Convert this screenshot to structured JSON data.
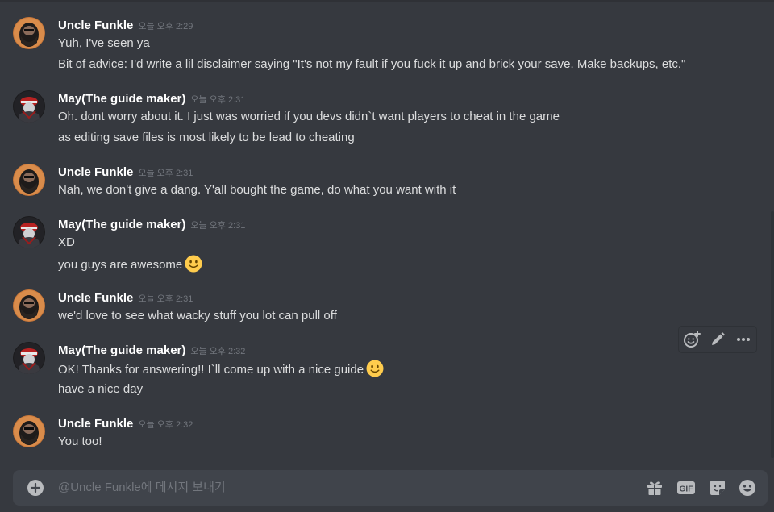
{
  "colors": {
    "background": "#36393f",
    "username": "#ffffff",
    "message_text": "#dcddde",
    "timestamp": "#72767d",
    "composer_bg": "#40444b",
    "icon": "#b9bbbe",
    "emoji_face": "#ffcc4d"
  },
  "messages": [
    {
      "author": "Uncle Funkle",
      "avatar": "uncle-funkle-avatar",
      "time": "오늘 오후 2:29",
      "lines": [
        "Yuh, I've seen ya",
        "Bit of advice: I'd write a lil disclaimer saying \"It's not my fault if you fuck it up and brick your save. Make backups, etc.\""
      ]
    },
    {
      "author": "May(The guide maker)",
      "avatar": "may-avatar",
      "time": "오늘 오후 2:31",
      "lines": [
        "Oh. dont worry about it. I just was worried if you devs didn`t want players to cheat in the game",
        "as editing save files is most likely to be lead to cheating"
      ]
    },
    {
      "author": "Uncle Funkle",
      "avatar": "uncle-funkle-avatar",
      "time": "오늘 오후 2:31",
      "lines": [
        "Nah, we don't give a dang. Y'all bought the game, do what you want with it"
      ]
    },
    {
      "author": "May(The guide maker)",
      "avatar": "may-avatar",
      "time": "오늘 오후 2:31",
      "lines": [
        "XD",
        "you guys are awesome"
      ],
      "emoji": "slightly-smiling-face"
    },
    {
      "author": "Uncle Funkle",
      "avatar": "uncle-funkle-avatar",
      "time": "오늘 오후 2:31",
      "lines": [
        "we'd love to see what wacky stuff you lot can pull off"
      ]
    },
    {
      "author": "May(The guide maker)",
      "avatar": "may-avatar",
      "time": "오늘 오후 2:32",
      "lines": [
        "OK! Thanks for answering!! I`ll come up with a nice guide",
        "have a nice day"
      ],
      "emoji": "slightly-smiling-face"
    },
    {
      "author": "Uncle Funkle",
      "avatar": "uncle-funkle-avatar",
      "time": "오늘 오후 2:32",
      "lines": [
        "You too!"
      ]
    }
  ],
  "message_actions": {
    "icons": [
      "add-reaction-icon",
      "edit-pencil-icon",
      "more-options-icon"
    ]
  },
  "composer": {
    "placeholder": "@Uncle Funkle에 메시지 보내기",
    "left_icon": "add-attachment-icon",
    "right_icons": [
      "gift-icon",
      "gif-icon",
      "sticker-icon",
      "emoji-picker-icon"
    ],
    "gif_label": "GIF"
  }
}
